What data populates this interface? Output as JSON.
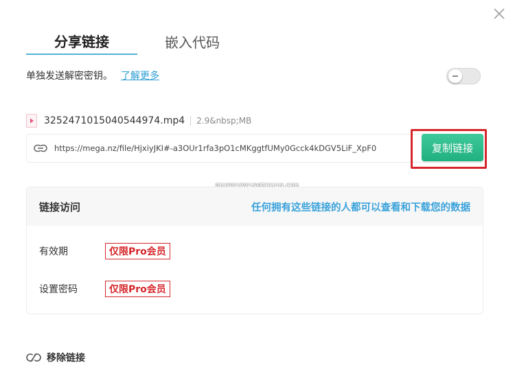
{
  "tabs": {
    "share_link": "分享链接",
    "embed_code": "嵌入代码"
  },
  "separate_key": {
    "label": "单独发送解密密钥。",
    "learn_more": "了解更多",
    "toggle_on": false
  },
  "file": {
    "icon": "video-file-icon",
    "name": "3252471015040544974.mp4",
    "size": "2.9&nbsp;MB"
  },
  "link": {
    "icon": "link-icon",
    "url": "https://mega.nz/file/HjxiyJKI#-a3OUr1rfa3pO1cMKggtfUMy0Gcck4kDGV5LiF_XpF0",
    "copy_button": "复制链接"
  },
  "watermark": "GUOWAIWANGZHUAN.COM",
  "access": {
    "title": "链接访问",
    "description": "任何拥有这些链接的人都可以查看和下载您的数据",
    "options": [
      {
        "label": "有效期",
        "badge": "仅限Pro会员"
      },
      {
        "label": "设置密码",
        "badge": "仅限Pro会员"
      }
    ]
  },
  "remove": {
    "icon": "unlink-icon",
    "label": "移除链接"
  },
  "colors": {
    "accent_blue": "#3aa2db",
    "copy_green": "#20b080",
    "highlight_red": "#d6262b"
  }
}
